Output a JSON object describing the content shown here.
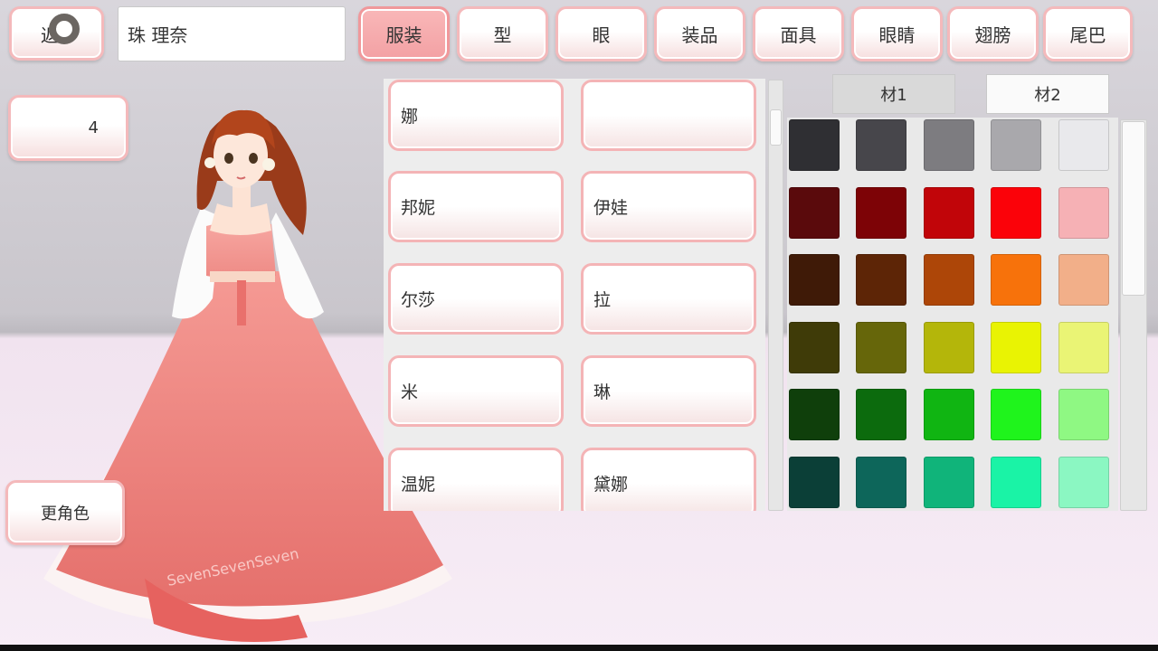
{
  "header": {
    "back_label": "返",
    "name_value": "珠 理奈",
    "tabs": [
      "服装",
      "型",
      "眼",
      "装品",
      "面具",
      "眼睛",
      "翅膀",
      "尾巴"
    ],
    "active_tab": "服装"
  },
  "counter_value": "4",
  "change_character_label": "更角色",
  "outfit_list": [
    [
      "娜",
      ""
    ],
    [
      "邦妮",
      "伊娃"
    ],
    [
      "尔莎",
      "拉"
    ],
    [
      "米",
      "琳"
    ],
    [
      "温妮",
      "黛娜"
    ]
  ],
  "material_tabs": [
    "材1",
    "材2"
  ],
  "active_material_tab": "材1",
  "palette": [
    [
      "#2f2f33",
      "#47464b",
      "#7d7c80",
      "#a9a8ac",
      "#e9e9ec"
    ],
    [
      "#5a0a0c",
      "#7d0306",
      "#c10509",
      "#fb0209",
      "#f6b1b5"
    ],
    [
      "#3f1a07",
      "#5d2506",
      "#ad4608",
      "#f7720b",
      "#f2af89"
    ],
    [
      "#3f3b08",
      "#66660a",
      "#b4b60a",
      "#e9f303",
      "#eaf475"
    ],
    [
      "#0f3f0b",
      "#0c6b0d",
      "#10b512",
      "#1ff41c",
      "#8ff883"
    ],
    [
      "#0b3f37",
      "#0d665a",
      "#10b47a",
      "#1af3a6",
      "#8bf7c2"
    ]
  ],
  "colors": {
    "accent_pink": "#f3a1a4",
    "button_border": "#f4b9bb"
  },
  "dress_text": "SevenSevenSeven"
}
